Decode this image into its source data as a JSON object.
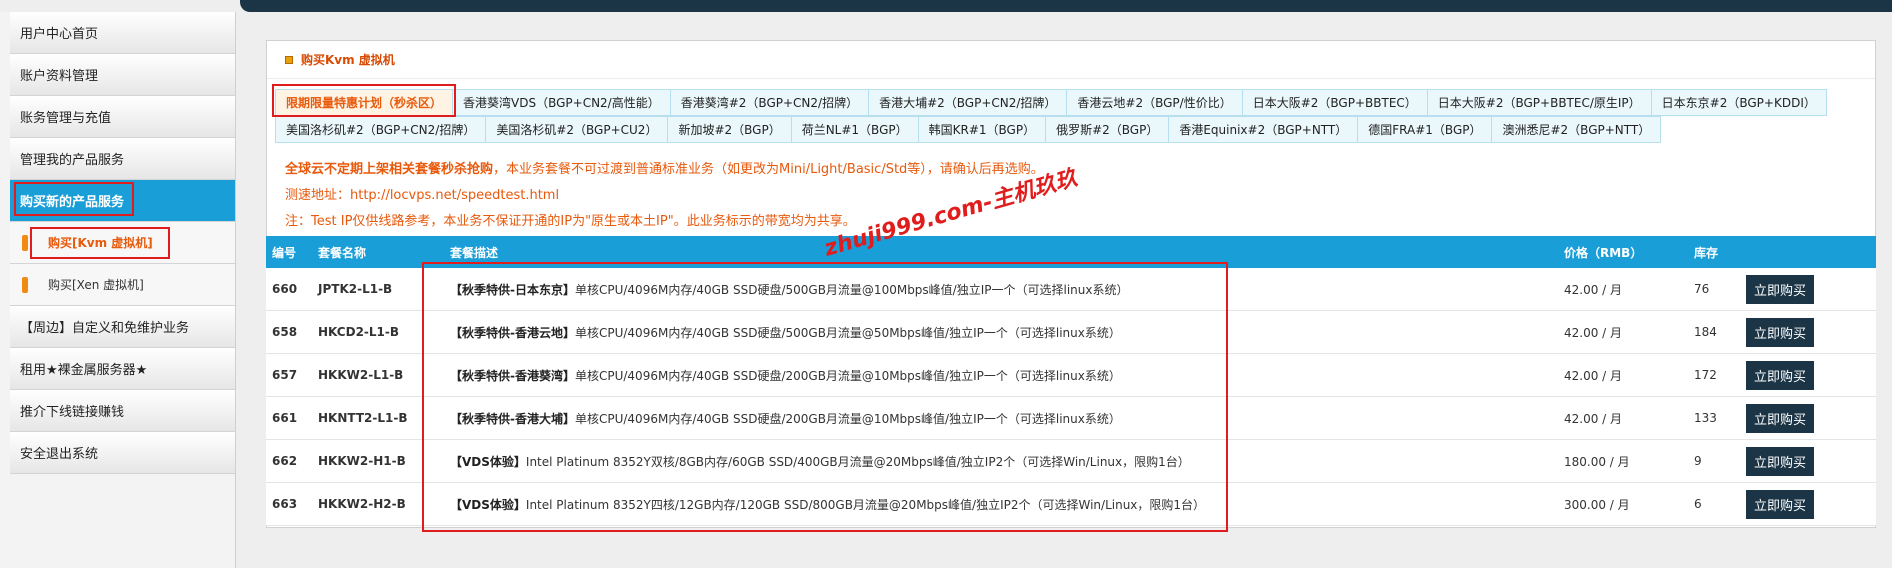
{
  "sidebar": {
    "items": [
      {
        "label": "用户中心首页"
      },
      {
        "label": "账户资料管理"
      },
      {
        "label": "账务管理与充值"
      },
      {
        "label": "管理我的产品服务"
      },
      {
        "label": "购买新的产品服务"
      },
      {
        "label": "购买[Kvm 虚拟机]"
      },
      {
        "label": "购买[Xen 虚拟机]"
      },
      {
        "label": "【周边】自定义和免维护业务"
      },
      {
        "label": "租用★裸金属服务器★"
      },
      {
        "label": "推介下线链接赚钱"
      },
      {
        "label": "安全退出系统"
      }
    ]
  },
  "panel": {
    "title": "购买Kvm 虚拟机"
  },
  "tabs": {
    "row1": [
      "限期限量特惠计划（秒杀区）",
      "香港葵湾VDS（BGP+CN2/高性能）",
      "香港葵湾#2（BGP+CN2/招牌）",
      "香港大埔#2（BGP+CN2/招牌）",
      "香港云地#2（BGP/性价比）",
      "日本大阪#2（BGP+BBTEC）",
      "日本大阪#2（BGP+BBTEC/原生IP）",
      "日本东京#2（BGP+KDDI）"
    ],
    "row2": [
      "美国洛杉矶#2（BGP+CN2/招牌）",
      "美国洛杉矶#2（BGP+CU2）",
      "新加坡#2（BGP）",
      "荷兰NL#1（BGP）",
      "韩国KR#1（BGP）",
      "俄罗斯#2（BGP）",
      "香港Equinix#2（BGP+NTT）",
      "德国FRA#1（BGP）",
      "澳洲悉尼#2（BGP+NTT）"
    ]
  },
  "notice": {
    "line1_bold": "全球云不定期上架相关套餐秒杀抢购",
    "line1_rest": "，本业务套餐不可过渡到普通标准业务（如更改为Mini/Light/Basic/Std等），请确认后再选购。",
    "line2": "测速地址：http://locvps.net/speedtest.html",
    "line3": "注：Test IP仅供线路参考，本业务不保证开通的IP为\"原生或本土IP\"。此业务标示的带宽均为共享。"
  },
  "watermark": "zhuji999.com-主机玖玖",
  "table": {
    "headers": {
      "id": "编号",
      "name": "套餐名称",
      "desc": "套餐描述",
      "price": "价格（RMB）",
      "stock": "库存"
    },
    "buy_label": "立即购买",
    "rows": [
      {
        "id": "660",
        "name": "JPTK2-L1-B",
        "tag": "【秋季特供-日本东京】",
        "desc": "单核CPU/4096M内存/40GB SSD硬盘/500GB月流量@100Mbps峰值/独立IP一个（可选择linux系统）",
        "price": "42.00 / 月",
        "stock": "76"
      },
      {
        "id": "658",
        "name": "HKCD2-L1-B",
        "tag": "【秋季特供-香港云地】",
        "desc": "单核CPU/4096M内存/40GB SSD硬盘/500GB月流量@50Mbps峰值/独立IP一个（可选择linux系统）",
        "price": "42.00 / 月",
        "stock": "184"
      },
      {
        "id": "657",
        "name": "HKKW2-L1-B",
        "tag": "【秋季特供-香港葵湾】",
        "desc": "单核CPU/4096M内存/40GB SSD硬盘/200GB月流量@10Mbps峰值/独立IP一个（可选择linux系统）",
        "price": "42.00 / 月",
        "stock": "172"
      },
      {
        "id": "661",
        "name": "HKNTT2-L1-B",
        "tag": "【秋季特供-香港大埔】",
        "desc": "单核CPU/4096M内存/40GB SSD硬盘/200GB月流量@10Mbps峰值/独立IP一个（可选择linux系统）",
        "price": "42.00 / 月",
        "stock": "133"
      },
      {
        "id": "662",
        "name": "HKKW2-H1-B",
        "tag": "【VDS体验】",
        "desc": "Intel Platinum 8352Y双核/8GB内存/60GB SSD/400GB月流量@20Mbps峰值/独立IP2个（可选择Win/Linux，限购1台）",
        "price": "180.00 / 月",
        "stock": "9"
      },
      {
        "id": "663",
        "name": "HKKW2-H2-B",
        "tag": "【VDS体验】",
        "desc": "Intel Platinum 8352Y四核/12GB内存/120GB SSD/800GB月流量@20Mbps峰值/独立IP2个（可选择Win/Linux，限购1台）",
        "price": "300.00 / 月",
        "stock": "6"
      }
    ]
  }
}
